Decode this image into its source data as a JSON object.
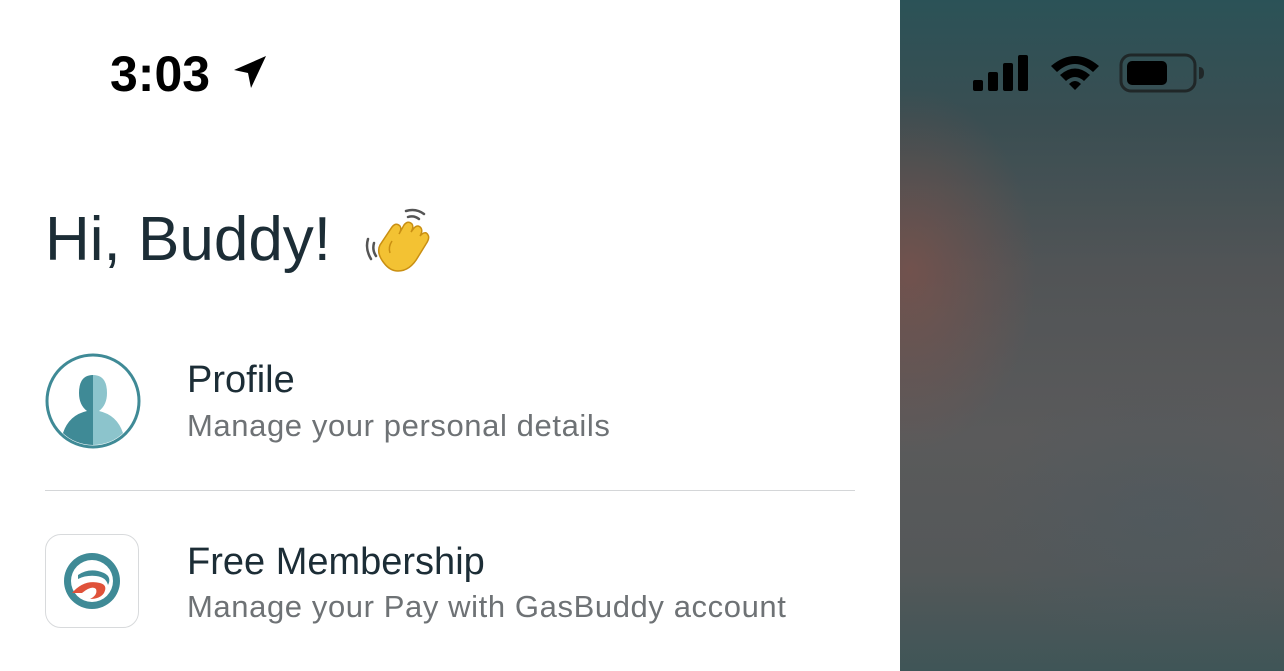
{
  "status_bar": {
    "time": "3:03",
    "location_icon": "location-arrow-icon",
    "signal_icon": "cellular-signal-icon",
    "wifi_icon": "wifi-icon",
    "battery_icon": "battery-icon"
  },
  "greeting": {
    "text": "Hi, Buddy!",
    "emoji_icon": "waving-hand-icon"
  },
  "menu": {
    "items": [
      {
        "title": "Profile",
        "subtitle": "Manage your personal details",
        "icon": "profile-avatar-icon"
      },
      {
        "title": "Free Membership",
        "subtitle": "Manage your Pay with GasBuddy account",
        "icon": "gasbuddy-logo-icon"
      }
    ]
  },
  "colors": {
    "title_text": "#1c2d36",
    "subtitle_text": "#6e7275",
    "accent_teal": "#3f8a96",
    "logo_red": "#e0523a",
    "divider": "#d4d6d8"
  }
}
